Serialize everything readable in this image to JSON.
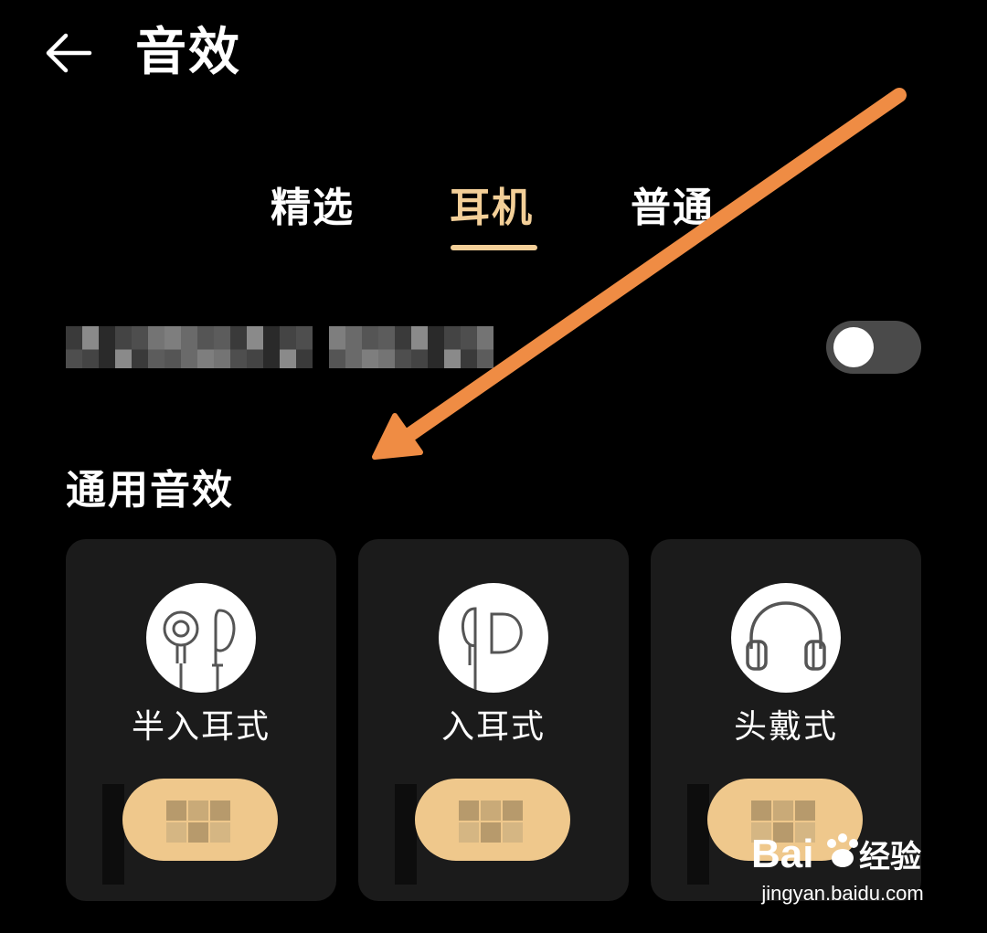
{
  "header": {
    "title": "音效",
    "back_icon": "arrow-left-icon"
  },
  "tabs": [
    {
      "label": "精选",
      "active": false
    },
    {
      "label": "耳机",
      "active": true
    },
    {
      "label": "普通",
      "active": false
    }
  ],
  "setting": {
    "toggle_on": false
  },
  "section": {
    "title": "通用音效"
  },
  "cards": [
    {
      "label": "半入耳式",
      "icon": "semi-in-ear-earphone-icon"
    },
    {
      "label": "入耳式",
      "icon": "in-ear-earphone-icon"
    },
    {
      "label": "头戴式",
      "icon": "over-ear-headphone-icon"
    }
  ],
  "watermark": {
    "url": "jingyan.baidu.com"
  },
  "colors": {
    "background": "#000000",
    "accent": "#f3cf98",
    "card": "#1b1b1b",
    "arrow": "#ef8c44"
  }
}
